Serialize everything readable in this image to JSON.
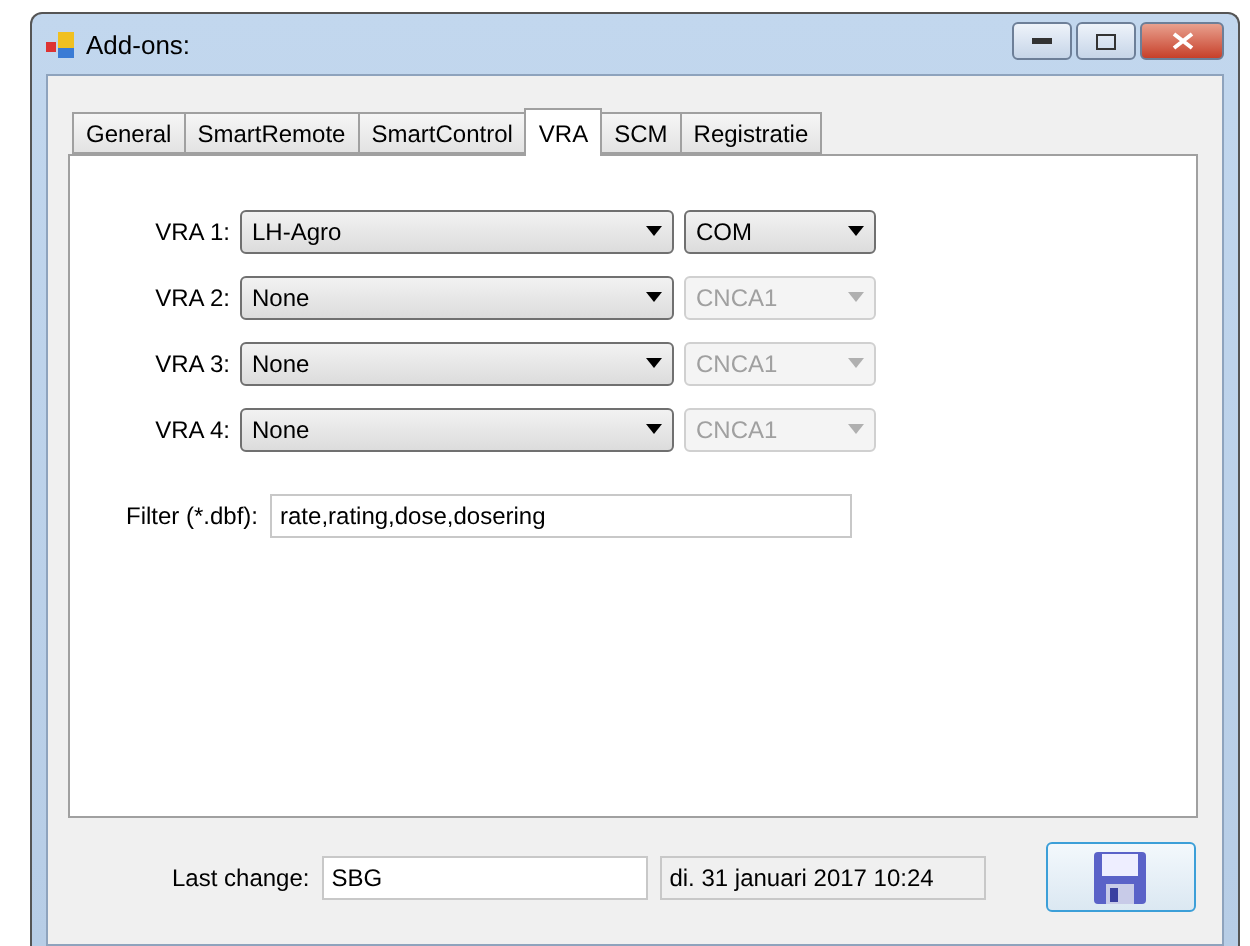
{
  "window": {
    "title": "Add-ons:"
  },
  "tabs": [
    {
      "label": "General",
      "selected": false
    },
    {
      "label": "SmartRemote",
      "selected": false
    },
    {
      "label": "SmartControl",
      "selected": false
    },
    {
      "label": "VRA",
      "selected": true
    },
    {
      "label": "SCM",
      "selected": false
    },
    {
      "label": "Registratie",
      "selected": false
    }
  ],
  "vra_rows": [
    {
      "label": "VRA 1:",
      "device": "LH-Agro",
      "port": "COM",
      "port_disabled": false
    },
    {
      "label": "VRA 2:",
      "device": "None",
      "port": "CNCA1",
      "port_disabled": true
    },
    {
      "label": "VRA 3:",
      "device": "None",
      "port": "CNCA1",
      "port_disabled": true
    },
    {
      "label": "VRA 4:",
      "device": "None",
      "port": "CNCA1",
      "port_disabled": true
    }
  ],
  "filter": {
    "label": "Filter (*.dbf):",
    "value": "rate,rating,dose,dosering"
  },
  "footer": {
    "label": "Last change:",
    "user": "SBG",
    "date": "di. 31 januari 2017 10:24"
  }
}
